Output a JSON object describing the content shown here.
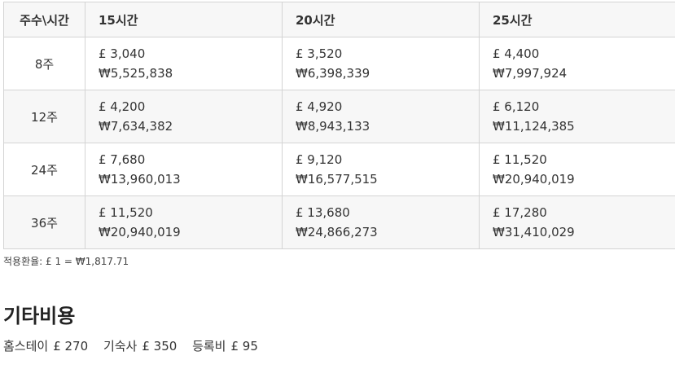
{
  "table": {
    "corner_header": "주수\\시간",
    "columns": [
      "15시간",
      "20시간",
      "25시간"
    ],
    "rows": [
      {
        "week": "8주",
        "prices": [
          {
            "gbp": "£ 3,040",
            "krw": "₩5,525,838"
          },
          {
            "gbp": "£ 3,520",
            "krw": "₩6,398,339"
          },
          {
            "gbp": "£ 4,400",
            "krw": "₩7,997,924"
          }
        ]
      },
      {
        "week": "12주",
        "prices": [
          {
            "gbp": "£ 4,200",
            "krw": "₩7,634,382"
          },
          {
            "gbp": "£ 4,920",
            "krw": "₩8,943,133"
          },
          {
            "gbp": "£ 6,120",
            "krw": "₩11,124,385"
          }
        ]
      },
      {
        "week": "24주",
        "prices": [
          {
            "gbp": "£ 7,680",
            "krw": "₩13,960,013"
          },
          {
            "gbp": "£ 9,120",
            "krw": "₩16,577,515"
          },
          {
            "gbp": "£ 11,520",
            "krw": "₩20,940,019"
          }
        ]
      },
      {
        "week": "36주",
        "prices": [
          {
            "gbp": "£ 11,520",
            "krw": "₩20,940,019"
          },
          {
            "gbp": "£ 13,680",
            "krw": "₩24,866,273"
          },
          {
            "gbp": "£ 17,280",
            "krw": "₩31,410,029"
          }
        ]
      }
    ]
  },
  "rate_note": "적용환율: £ 1 = ₩1,817.71",
  "other": {
    "title": "기타비용",
    "items": [
      {
        "label": "홈스테이",
        "amount": "£ 270"
      },
      {
        "label": "기숙사",
        "amount": "£ 350"
      },
      {
        "label": "등록비",
        "amount": "£ 95"
      }
    ]
  }
}
